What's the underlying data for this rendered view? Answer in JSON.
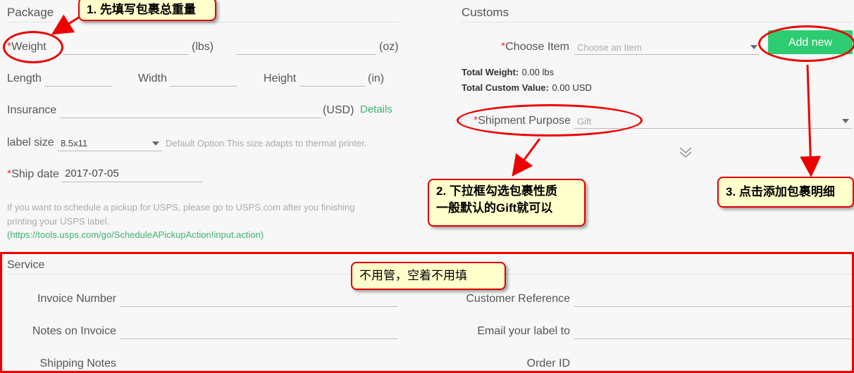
{
  "package": {
    "title": "Package",
    "weight_label": "Weight",
    "lbs_unit": "(lbs)",
    "oz_unit": "(oz)",
    "length_label": "Length",
    "width_label": "Width",
    "height_label": "Height",
    "in_unit": "(in)",
    "insurance_label": "Insurance",
    "usd_unit": "(USD)",
    "details_link": "Details",
    "label_size_label": "label size",
    "label_size_value": "8.5x11",
    "label_size_hint": "Default Option.This size adapts to thermal printer.",
    "ship_date_label": "Ship date",
    "ship_date_value": "2017-07-05",
    "pickup_note_1": "If you want to schedule a pickup for USPS, please go to USPS.com after you finishing",
    "pickup_note_2": "printing your USPS label.",
    "pickup_link": "(https://tools.usps.com/go/ScheduleAPickupAction!input.action)"
  },
  "customs": {
    "title": "Customs",
    "choose_item_label": "Choose Item",
    "choose_item_placeholder": "Choose an Item",
    "add_new_label": "Add new",
    "total_weight_label": "Total Weight:",
    "total_weight_value": "0.00 lbs",
    "total_custom_value_label": "Total Custom Value:",
    "total_custom_value_value": "0.00 USD",
    "shipment_purpose_label": "Shipment Purpose",
    "shipment_purpose_value": "Gift"
  },
  "service": {
    "title": "Service",
    "invoice_number_label": "Invoice Number",
    "customer_reference_label": "Customer Reference",
    "notes_on_invoice_label": "Notes on Invoice",
    "email_label": "Email your label to",
    "shipping_notes_label": "Shipping Notes",
    "order_id_label": "Order ID"
  },
  "annotations": {
    "step1": "1. 先填写包裹总重量",
    "step2_line1": "2. 下拉框勾选包裹性质",
    "step2_line2": "一般默认的Gift就可以",
    "step3": "3. 点击添加包裹明细",
    "service_note": "不用管，空着不用填"
  },
  "icons": {
    "required_marker": "*",
    "expand": "chevron-double-down-icon"
  },
  "colors": {
    "accent_green": "#2ecc71",
    "annotation_red": "#dd0000",
    "callout_bg": "#ffffcc"
  }
}
